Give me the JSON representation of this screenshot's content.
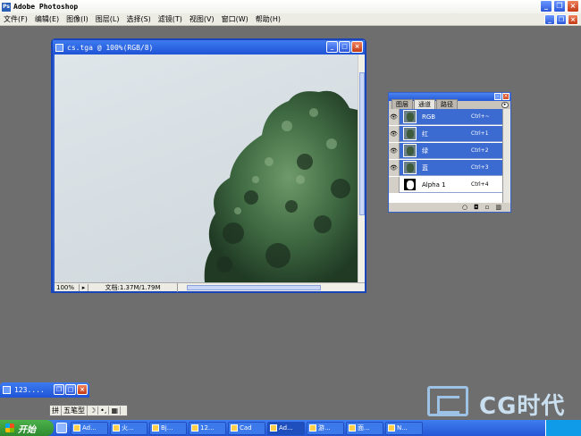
{
  "app": {
    "title": "Adobe Photoshop",
    "icon": "photoshop-icon"
  },
  "menu": [
    "文件(F)",
    "编辑(E)",
    "图像(I)",
    "图层(L)",
    "选择(S)",
    "滤镜(T)",
    "视图(V)",
    "窗口(W)",
    "帮助(H)"
  ],
  "document": {
    "title": "cs.tga @ 100%(RGB/8)",
    "zoom": "100%",
    "info": "文档:1.37M/1.79M"
  },
  "channels_panel": {
    "tabs": [
      "图层",
      "通道",
      "路径"
    ],
    "active_tab": "通道",
    "channels": [
      {
        "name": "RGB",
        "shortcut": "Ctrl+~",
        "visible": true,
        "selected": true
      },
      {
        "name": "红",
        "shortcut": "Ctrl+1",
        "visible": true,
        "selected": true
      },
      {
        "name": "绿",
        "shortcut": "Ctrl+2",
        "visible": true,
        "selected": true
      },
      {
        "name": "蓝",
        "shortcut": "Ctrl+3",
        "visible": true,
        "selected": true
      },
      {
        "name": "Alpha 1",
        "shortcut": "Ctrl+4",
        "visible": false,
        "selected": false
      }
    ]
  },
  "minimized_window": {
    "title": "123...."
  },
  "ime": {
    "label": "五笔型"
  },
  "taskbar": {
    "start_label": "开始",
    "tasks": [
      "Ad...",
      "火...",
      "Bj...",
      "12...",
      "Cad",
      "Ad...",
      "游...",
      "面...",
      "N..."
    ]
  },
  "watermark": {
    "text": "CG时代"
  },
  "colors": {
    "selection": "#3b6ad0",
    "titlebar": "#2457d4",
    "workspace": "#6e6e6e"
  }
}
